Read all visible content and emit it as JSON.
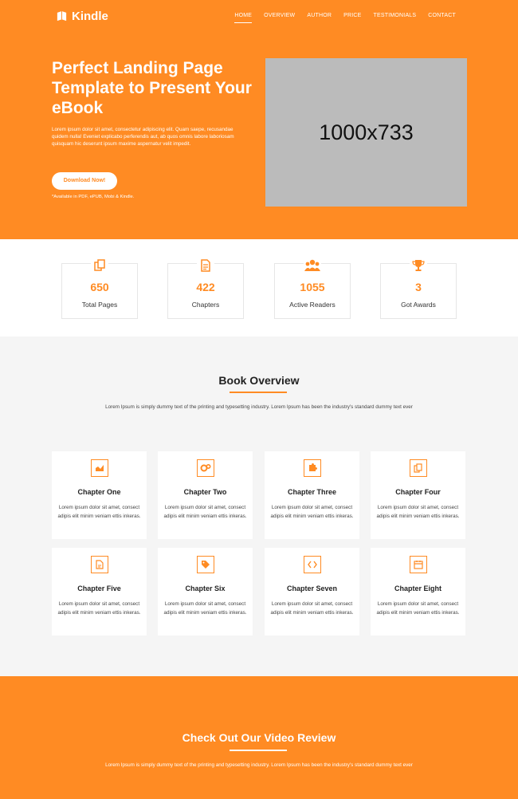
{
  "colors": {
    "accent": "#ff8b23",
    "light_bg": "#f5f5f5",
    "card_bg": "#ffffff"
  },
  "header": {
    "logo_text": "Kindle",
    "nav": [
      "HOME",
      "OVERVIEW",
      "AUTHOR",
      "PRICE",
      "TESTIMONIALS",
      "CONTACT"
    ],
    "active_nav": "HOME"
  },
  "hero": {
    "title": "Perfect Landing Page Template to Present Your eBook",
    "text": "Lorem ipsum dolor sit amet, consectetur adipiscing elit. Quam saepe, recusandae quidem nulla! Eveniet explicabo perferendis aut, ab quos omnis labore laboriosam quisquam hic deserunt ipsum maxime aspernatur velit impedit.",
    "button": "Download Now!",
    "available": "*Available in PDF, ePUB, Mobi & Kindle.",
    "image_placeholder": "1000x733"
  },
  "stats": [
    {
      "icon": "copy-icon",
      "value": "650",
      "label": "Total Pages"
    },
    {
      "icon": "document-icon",
      "value": "422",
      "label": "Chapters"
    },
    {
      "icon": "users-icon",
      "value": "1055",
      "label": "Active Readers"
    },
    {
      "icon": "trophy-icon",
      "value": "3",
      "label": "Got Awards"
    }
  ],
  "overview": {
    "title": "Book Overview",
    "text": "Lorem Ipsum is simply dummy text of the printing and typesetting industry. Lorem Ipsum has been the industry's standard dummy text ever",
    "chapters": [
      {
        "icon": "chart-icon",
        "title": "Chapter One",
        "text": "Lorem ipsum dolor sit amet, consect adipis elit minim veniam ettis inkeras."
      },
      {
        "icon": "gears-icon",
        "title": "Chapter Two",
        "text": "Lorem ipsum dolor sit amet, consect adipis elit minim veniam ettis inkeras."
      },
      {
        "icon": "puzzle-icon",
        "title": "Chapter Three",
        "text": "Lorem ipsum dolor sit amet, consect adipis elit minim veniam ettis inkeras."
      },
      {
        "icon": "copy-icon",
        "title": "Chapter Four",
        "text": "Lorem ipsum dolor sit amet, consect adipis elit minim veniam ettis inkeras."
      },
      {
        "icon": "pdf-icon",
        "title": "Chapter Five",
        "text": "Lorem ipsum dolor sit amet, consect adipis elit minim veniam ettis inkeras."
      },
      {
        "icon": "tag-icon",
        "title": "Chapter Six",
        "text": "Lorem ipsum dolor sit amet, consect adipis elit minim veniam ettis inkeras."
      },
      {
        "icon": "code-icon",
        "title": "Chapter Seven",
        "text": "Lorem ipsum dolor sit amet, consect adipis elit minim veniam ettis inkeras."
      },
      {
        "icon": "calendar-icon",
        "title": "Chapter Eight",
        "text": "Lorem ipsum dolor sit amet, consect adipis elit minim veniam ettis inkeras."
      }
    ]
  },
  "video": {
    "title": "Check Out Our Video Review",
    "text": "Lorem Ipsum is simply dummy text of the printing and typesetting industry. Lorem Ipsum has been the industry's standard dummy text ever"
  }
}
